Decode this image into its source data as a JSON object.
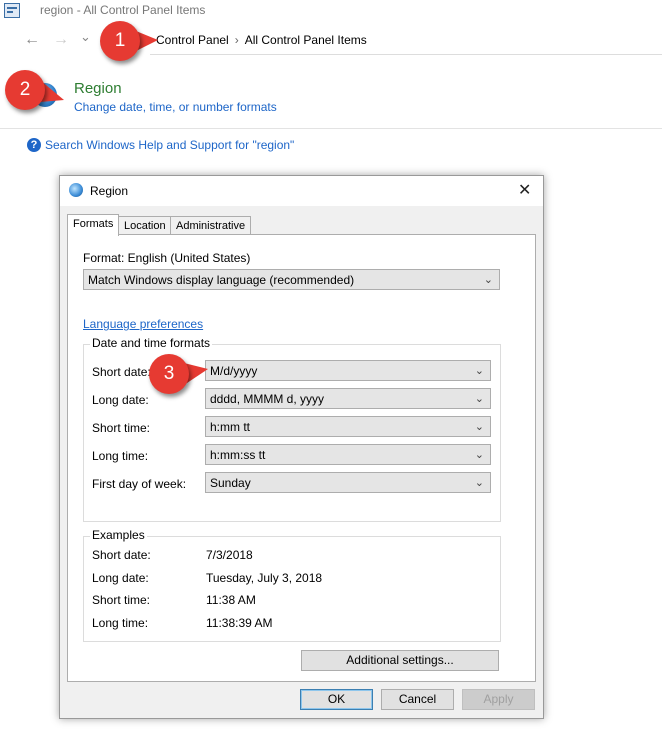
{
  "window": {
    "title": "region - All Control Panel Items"
  },
  "nav": {
    "back_icon": "←",
    "forward_icon": "→",
    "recent_icon": "⌄",
    "breadcrumb": [
      "Control Panel",
      "All Control Panel Items"
    ],
    "separator": "›"
  },
  "callouts": [
    "1",
    "2",
    "3"
  ],
  "results": {
    "title": "Region",
    "subtitle": "Change date, time, or number formats",
    "help_icon": "?",
    "help_link": "Search Windows Help and Support for \"region\""
  },
  "dialog": {
    "title": "Region",
    "close": "✕",
    "tabs": [
      "Formats",
      "Location",
      "Administrative"
    ],
    "format_label": "Format: English (United States)",
    "format_value": "Match Windows display language (recommended)",
    "language_link": "Language preferences",
    "datetime_group": "Date and time formats",
    "fields": [
      {
        "label": "Short date:",
        "value": "M/d/yyyy"
      },
      {
        "label": "Long date:",
        "value": "dddd, MMMM d, yyyy"
      },
      {
        "label": "Short time:",
        "value": "h:mm tt"
      },
      {
        "label": "Long time:",
        "value": "h:mm:ss tt"
      },
      {
        "label": "First day of week:",
        "value": "Sunday"
      }
    ],
    "examples_group": "Examples",
    "examples": [
      {
        "label": "Short date:",
        "value": "7/3/2018"
      },
      {
        "label": "Long date:",
        "value": "Tuesday, July 3, 2018"
      },
      {
        "label": "Short time:",
        "value": "11:38 AM"
      },
      {
        "label": "Long time:",
        "value": "11:38:39 AM"
      }
    ],
    "additional_settings": "Additional settings...",
    "ok": "OK",
    "cancel": "Cancel",
    "apply": "Apply",
    "chevron": "⌄"
  },
  "colors": {
    "callout": "#e63a32",
    "link": "#1e66c8",
    "region_title": "#2e7d32"
  }
}
